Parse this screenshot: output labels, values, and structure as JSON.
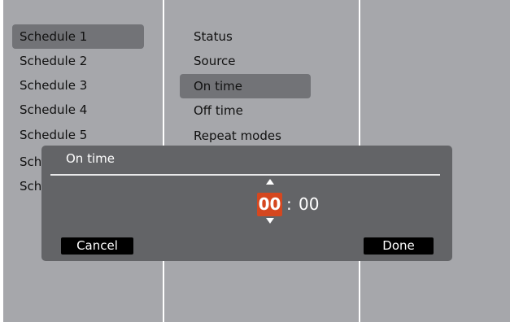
{
  "menu": {
    "schedules": [
      "Schedule 1",
      "Schedule 2",
      "Schedule 3",
      "Schedule 4",
      "Schedule 5",
      "Sch",
      "Sch"
    ],
    "selected_schedule": "Schedule 1",
    "options": [
      "Status",
      "Source",
      "On time",
      "Off time",
      "Repeat modes"
    ],
    "selected_option": "On time"
  },
  "dialog": {
    "title": "On time",
    "hour": "00",
    "separator": ":",
    "minute": "00",
    "cancel_label": "Cancel",
    "done_label": "Done"
  },
  "colors": {
    "background": "#a6a7ab",
    "highlight": "#727377",
    "dialog": "#636467",
    "hour_accent": "#d5471f"
  }
}
